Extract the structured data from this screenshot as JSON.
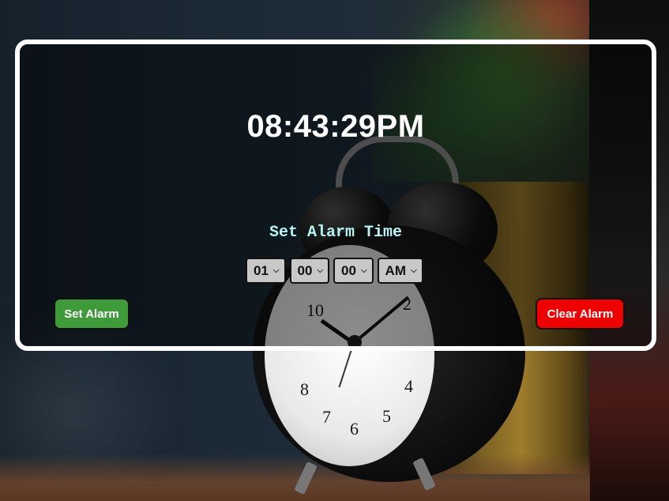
{
  "clock": {
    "current_time": "08:43:29PM"
  },
  "alarm": {
    "title": "Set Alarm Time",
    "hour": "01",
    "minute": "00",
    "second": "00",
    "ampm": "AM"
  },
  "buttons": {
    "set_label": "Set Alarm",
    "clear_label": "Clear Alarm"
  },
  "background": {
    "clock_numerals": [
      "10",
      "8",
      "7",
      "6",
      "5",
      "4",
      "2"
    ]
  },
  "colors": {
    "set_button": "#3f9a3a",
    "clear_button": "#ee0000",
    "title_text": "#b9f3f4",
    "panel_border": "#ffffff"
  },
  "icons": {
    "dropdown": "chevron-down-icon"
  }
}
